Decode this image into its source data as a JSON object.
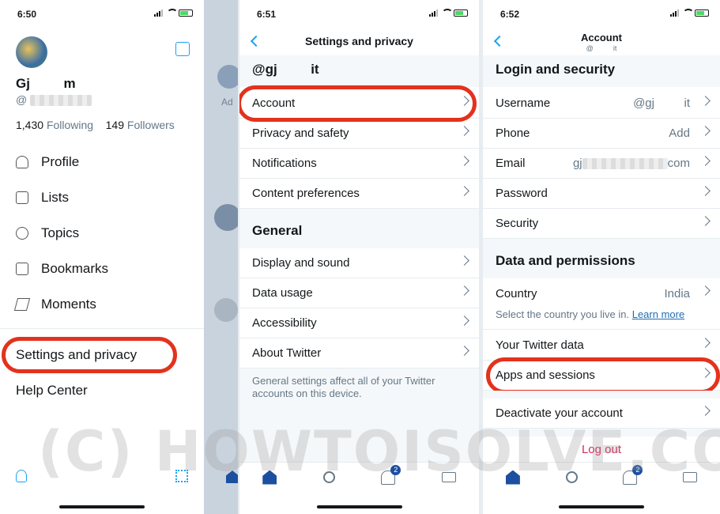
{
  "screen1": {
    "time": "6:50",
    "name": "Gj         m",
    "handle": "@",
    "following_count": "1,430",
    "following_label": "Following",
    "followers_count": "149",
    "followers_label": "Followers",
    "menu": [
      "Profile",
      "Lists",
      "Topics",
      "Bookmarks",
      "Moments"
    ],
    "settings": "Settings and privacy",
    "help": "Help Center",
    "bg_peek": "Ad"
  },
  "screen2": {
    "time": "6:51",
    "title": "Settings and privacy",
    "handle": "@gj         it",
    "account_rows": [
      "Account",
      "Privacy and safety",
      "Notifications",
      "Content preferences"
    ],
    "general_header": "General",
    "general_rows": [
      "Display and sound",
      "Data usage",
      "Accessibility",
      "About Twitter"
    ],
    "footer_note": "General settings affect all of your Twitter accounts on this device.",
    "notif_badge": "2"
  },
  "screen3": {
    "time": "6:52",
    "title": "Account",
    "subtitle": "@          it",
    "login_header": "Login and security",
    "username_label": "Username",
    "username_value": "@gj         it",
    "phone_label": "Phone",
    "phone_value": "Add",
    "email_label": "Email",
    "email_value_start": "gj",
    "email_value_end": "com",
    "password_label": "Password",
    "security_label": "Security",
    "data_header": "Data and permissions",
    "country_label": "Country",
    "country_value": "India",
    "country_help": "Select the country you live in.",
    "learn_more": "Learn more",
    "twitter_data": "Your Twitter data",
    "apps_sessions": "Apps and sessions",
    "deactivate": "Deactivate your account",
    "logout": "Log out",
    "notif_badge": "2"
  },
  "watermark": "(C) HOWTOISOLVE.COM",
  "colors": {
    "accent": "#1da1f2",
    "highlight": "#e3321d",
    "logout": "#e0245e",
    "tab_active": "#1d4fa0"
  }
}
